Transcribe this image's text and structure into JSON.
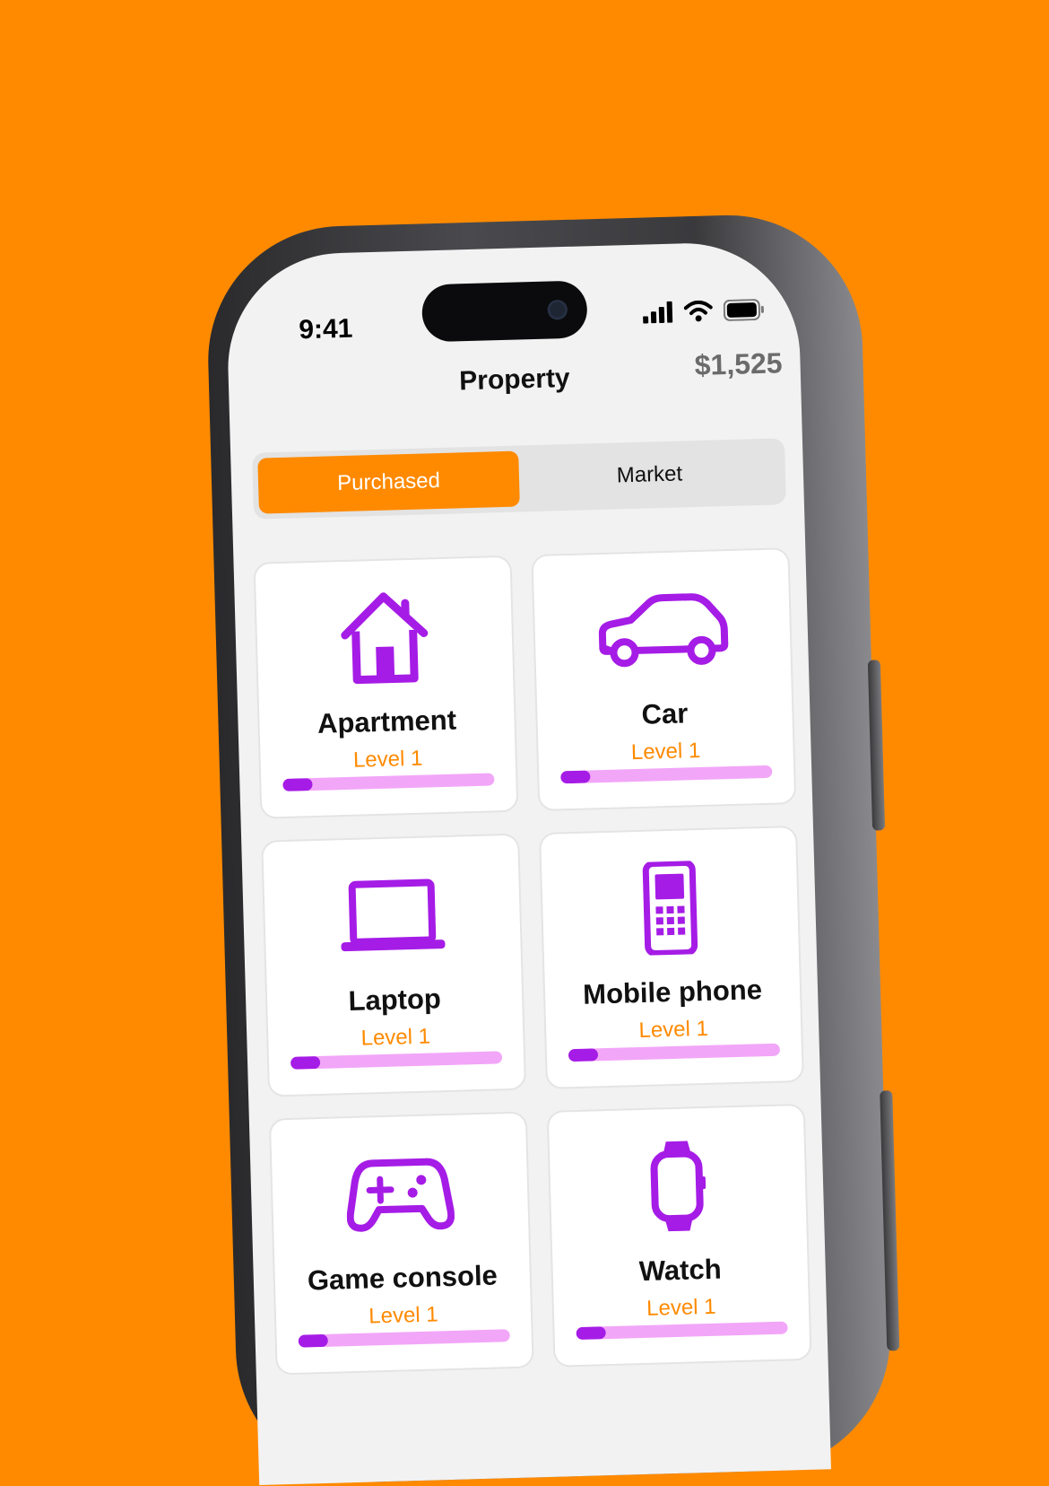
{
  "status": {
    "time": "9:41"
  },
  "header": {
    "title": "Property",
    "balance": "$1,525"
  },
  "tabs": [
    {
      "label": "Purchased",
      "active": true
    },
    {
      "label": "Market",
      "active": false
    }
  ],
  "colors": {
    "accent": "#FF8A00",
    "icon": "#A51CE6",
    "bar_track": "#F2A6F8"
  },
  "items": [
    {
      "name": "Apartment",
      "level": "Level 1",
      "icon": "house-icon",
      "progress": 0.14
    },
    {
      "name": "Car",
      "level": "Level 1",
      "icon": "car-icon",
      "progress": 0.14
    },
    {
      "name": "Laptop",
      "level": "Level 1",
      "icon": "laptop-icon",
      "progress": 0.14
    },
    {
      "name": "Mobile phone",
      "level": "Level 1",
      "icon": "mobile-phone-icon",
      "progress": 0.14
    },
    {
      "name": "Game console",
      "level": "Level 1",
      "icon": "gamepad-icon",
      "progress": 0.14
    },
    {
      "name": "Watch",
      "level": "Level 1",
      "icon": "watch-icon",
      "progress": 0.14
    }
  ]
}
